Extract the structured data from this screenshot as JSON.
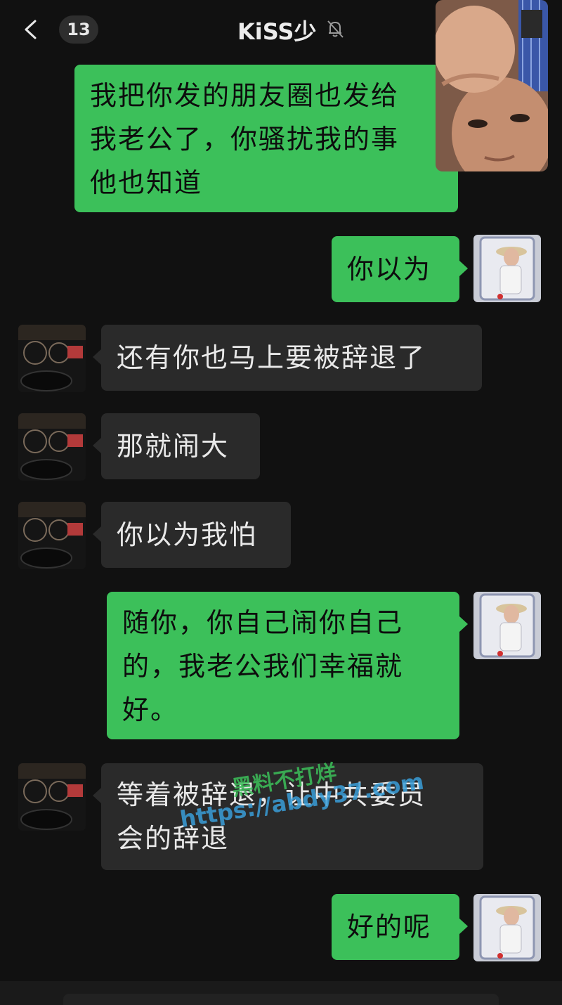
{
  "header": {
    "unread_count": "13",
    "title": "KiSS少",
    "icons": {
      "back": "chevron-left-icon",
      "mute": "bell-off-icon"
    }
  },
  "messages": [
    {
      "side": "sent",
      "lines": [
        "我把你发的朋友圈也发给",
        "我老公了，你骚扰我的事",
        "他也知道"
      ]
    },
    {
      "side": "sent",
      "lines": [
        "你以为"
      ]
    },
    {
      "side": "received",
      "lines": [
        "还有你也马上要被辞退了"
      ]
    },
    {
      "side": "received",
      "lines": [
        "那就闹大"
      ]
    },
    {
      "side": "received",
      "lines": [
        "你以为我怕"
      ]
    },
    {
      "side": "sent",
      "lines": [
        "随你，你自己闹你自己",
        "的，我老公我们幸福就",
        "好。"
      ]
    },
    {
      "side": "received",
      "lines": [
        "等着被辞退，让中共委员",
        "会的辞退"
      ]
    },
    {
      "side": "sent",
      "lines": [
        "好的呢"
      ]
    }
  ],
  "watermark": {
    "line1": "黑料不打烊",
    "line2": "https://abdy37.com"
  },
  "colors": {
    "sent_bubble": "#3cc05a",
    "received_bubble": "#2a2a2a",
    "background": "#111111"
  }
}
